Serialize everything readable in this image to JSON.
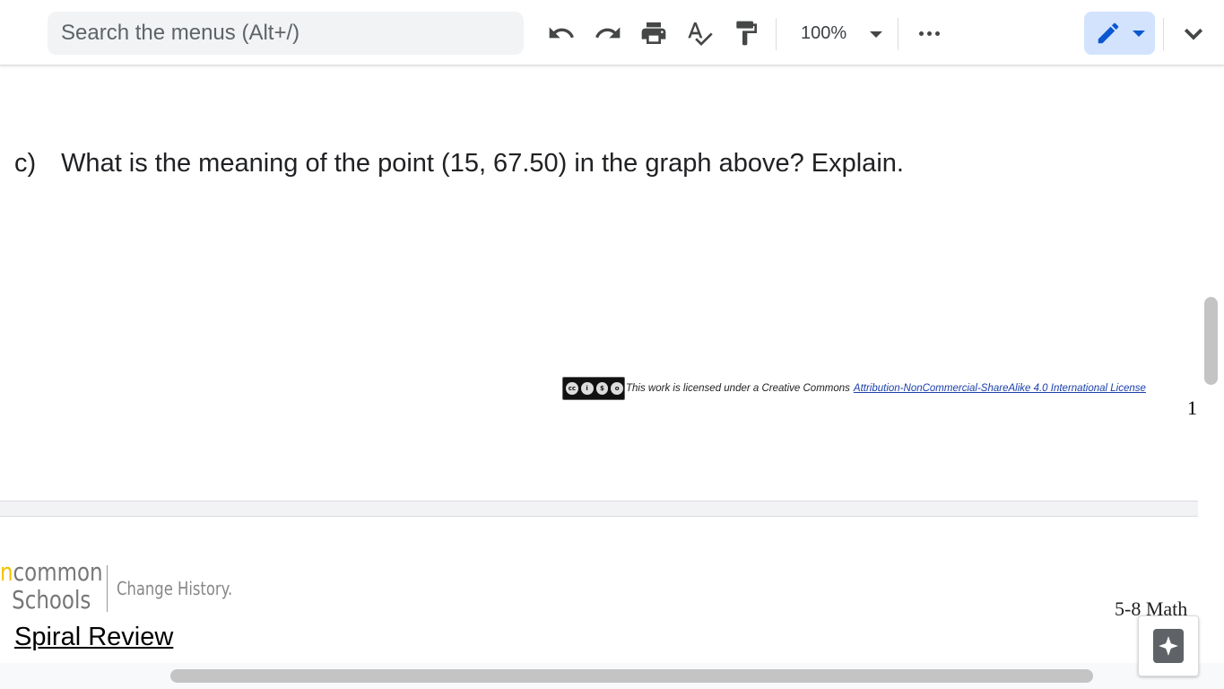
{
  "toolbar": {
    "search_placeholder": "Search the menus (Alt+/)",
    "zoom_value": "100%",
    "icons": [
      "undo-icon",
      "redo-icon",
      "print-icon",
      "spellcheck-icon",
      "paint-format-icon",
      "more-icon",
      "pencil-icon",
      "chevron-down-icon"
    ],
    "accent_color": "#0b57d0"
  },
  "document": {
    "question_label": "c)",
    "question_text": "What is the meaning of the point (15, 67.50) in the graph above? Explain.",
    "license_text": "This work is licensed under a Creative Commons",
    "license_link": "Attribution-NonCommercial-ShareAlike 4.0 International License",
    "page_number": "1",
    "logo_line1_accent": "n",
    "logo_line1": "common",
    "logo_line2": "Schools",
    "logo_tagline": "Change History.",
    "grade_label": "5-8 Math",
    "section_heading": "Spiral Review"
  }
}
